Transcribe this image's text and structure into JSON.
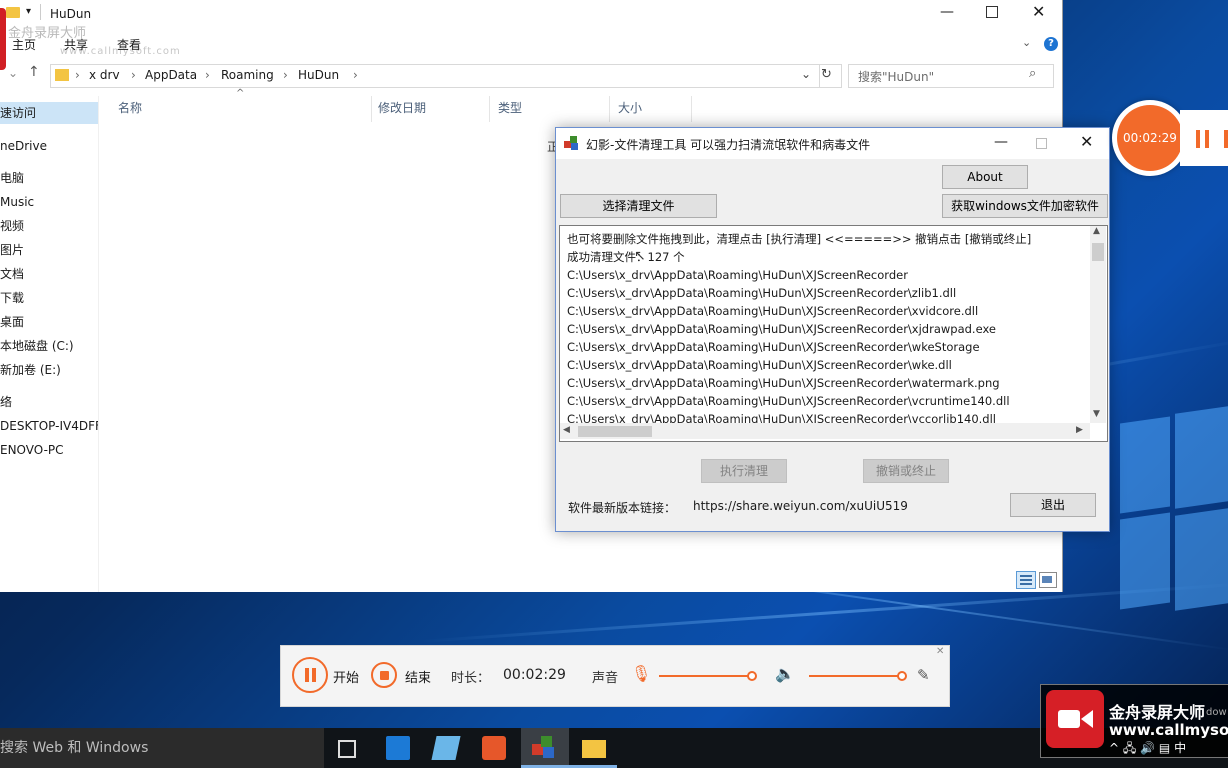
{
  "explorer": {
    "title": "HuDun",
    "ribbon": {
      "tab_home": "主页",
      "tab_share": "共享",
      "tab_view": "查看"
    },
    "breadcrumb": [
      "x drv",
      "AppData",
      "Roaming",
      "HuDun"
    ],
    "search_placeholder": "搜索\"HuDun\"",
    "columns": {
      "name": "名称",
      "modified": "修改日期",
      "type": "类型",
      "size": "大小"
    },
    "nav": [
      "速访问",
      "neDrive",
      "电脑",
      "Music",
      "视频",
      "图片",
      "文档",
      "下载",
      "桌面",
      "本地磁盘 (C:)",
      "新加卷 (E:)",
      "络",
      "DESKTOP-IV4DFF(",
      "ENOVO-PC"
    ],
    "truncated_text": "正"
  },
  "watermark": {
    "line1": "金舟录屏大师",
    "line2": "www.callmysoft.com"
  },
  "cleaner": {
    "title": "幻影-文件清理工具  可以强力扫清流氓软件和病毒文件",
    "about": "About",
    "select_files": "选择清理文件",
    "get_encrypt": "获取windows文件加密软件",
    "log": [
      "也可将要删除文件拖拽到此，清理点击 [执行清理]  <<=====>>   撤销点击 [撤销或终止]",
      "成功清理文件：127 个",
      "C:\\Users\\x_drv\\AppData\\Roaming\\HuDun\\XJScreenRecorder",
      "C:\\Users\\x_drv\\AppData\\Roaming\\HuDun\\XJScreenRecorder\\zlib1.dll",
      "C:\\Users\\x_drv\\AppData\\Roaming\\HuDun\\XJScreenRecorder\\xvidcore.dll",
      "C:\\Users\\x_drv\\AppData\\Roaming\\HuDun\\XJScreenRecorder\\xjdrawpad.exe",
      "C:\\Users\\x_drv\\AppData\\Roaming\\HuDun\\XJScreenRecorder\\wkeStorage",
      "C:\\Users\\x_drv\\AppData\\Roaming\\HuDun\\XJScreenRecorder\\wke.dll",
      "C:\\Users\\x_drv\\AppData\\Roaming\\HuDun\\XJScreenRecorder\\watermark.png",
      "C:\\Users\\x_drv\\AppData\\Roaming\\HuDun\\XJScreenRecorder\\vcruntime140.dll",
      "C:\\Users\\x_drv\\AppData\\Roaming\\HuDun\\XJScreenRecorder\\vccorlib140.dll"
    ],
    "execute": "执行清理",
    "undo": "撤销或终止",
    "link_label": "软件最新版本链接：",
    "link_url": "https://share.weiyun.com/xuUiU519",
    "exit": "退出"
  },
  "recorder": {
    "bubble_time": "00:02:29",
    "start": "开始",
    "stop": "结束",
    "duration_label": "时长：",
    "duration": "00:02:29",
    "sound_label": "声音",
    "accent": "#f26a2a"
  },
  "taskbar": {
    "search": "搜索 Web 和 Windows",
    "ime": "中",
    "brand_name": "金舟录屏大师",
    "brand_url": "www.callmyso",
    "edge_text": "dow"
  }
}
